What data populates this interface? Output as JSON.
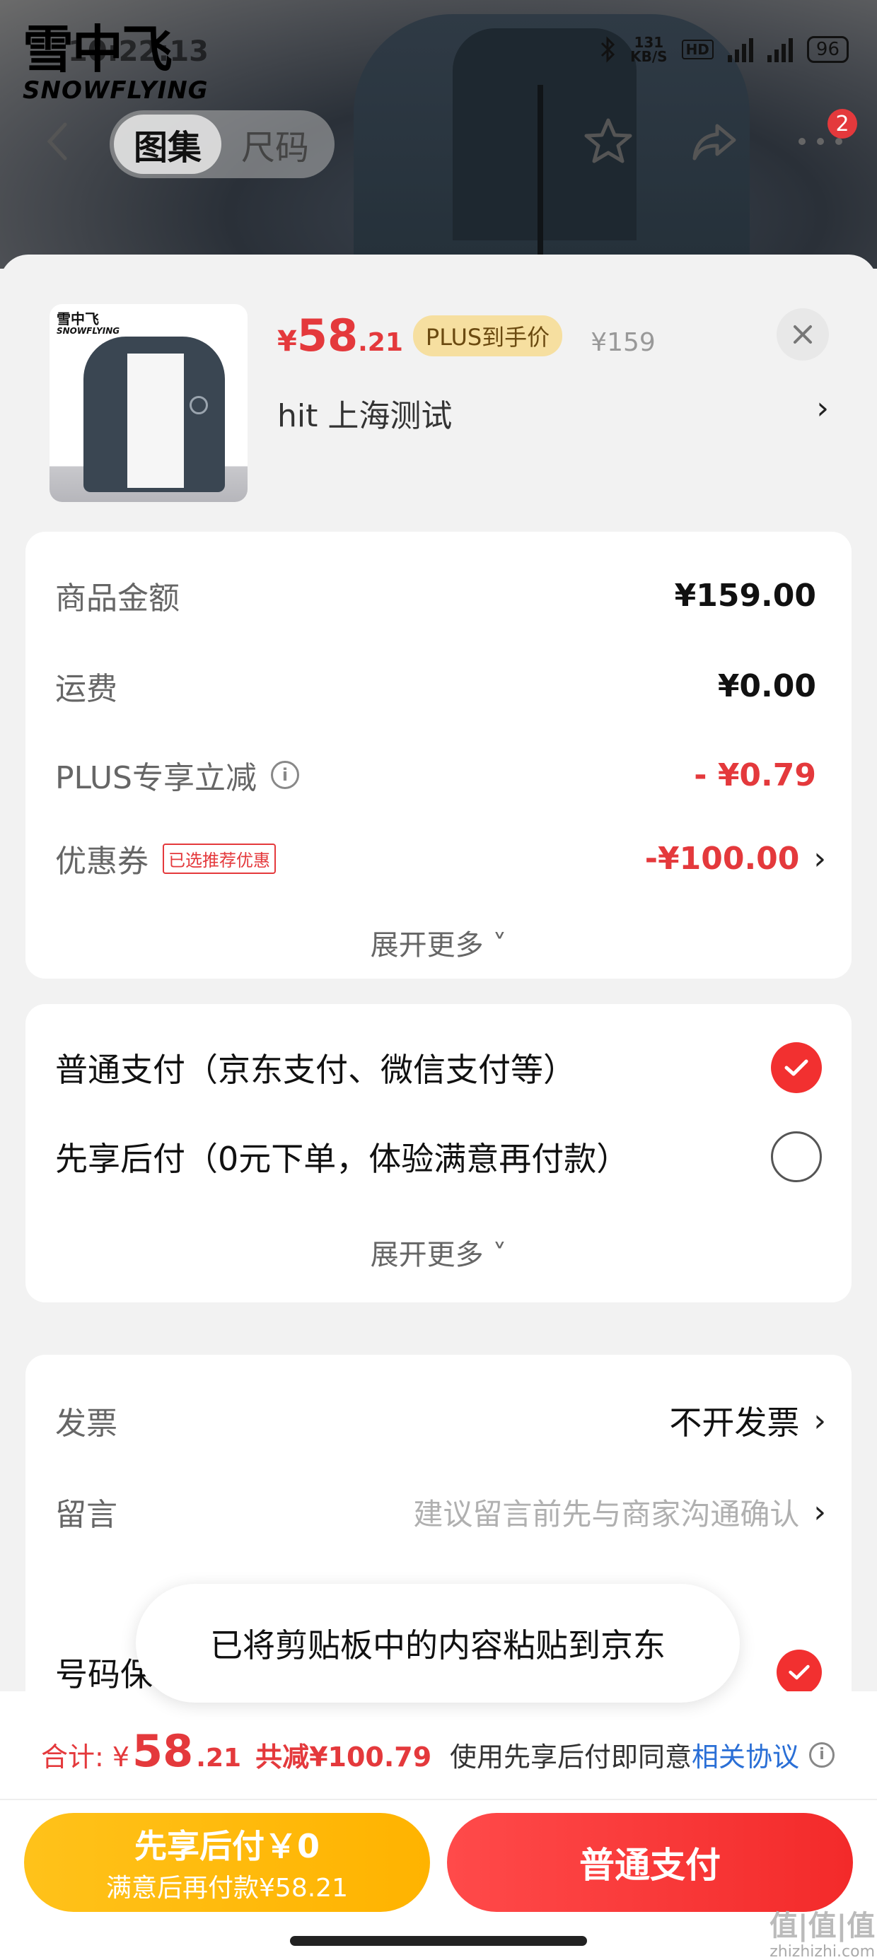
{
  "status_bar": {
    "time": "10:22:13",
    "network_speed": "131",
    "battery": "96"
  },
  "brand": {
    "cn": "雪中飞",
    "en": "SNOWFLYING"
  },
  "nav": {
    "tabs": [
      {
        "label": "图集",
        "active": true
      },
      {
        "label": "尺码",
        "active": false
      }
    ],
    "badge_count": "2"
  },
  "product": {
    "thumb_logo_cn": "雪中飞",
    "thumb_logo_en": "SNOWFLYING",
    "price_symbol": "¥",
    "price_int": "58",
    "price_dec": ".21",
    "plus_tag": "PLUS到手价",
    "original_price": "¥159",
    "address": "hit  上海测试"
  },
  "summary": {
    "rows": [
      {
        "label": "商品金额",
        "value": "¥159.00"
      },
      {
        "label": "运费",
        "value": "¥0.00"
      },
      {
        "label": "PLUS专享立减",
        "value": "- ¥0.79"
      },
      {
        "label": "优惠券",
        "tag": "已选推荐优惠",
        "value": "-¥100.00"
      }
    ],
    "expand": "展开更多"
  },
  "payment": {
    "options": [
      {
        "label": "普通支付（京东支付、微信支付等）",
        "selected": true
      },
      {
        "label": "先享后付（0元下单，体验满意再付款）",
        "selected": false
      }
    ],
    "expand": "展开更多"
  },
  "extra": {
    "invoice_label": "发票",
    "invoice_value": "不开发票",
    "note_label": "留言",
    "note_placeholder": "建议留言前先与商家沟通确认"
  },
  "protect": {
    "label": "号码保"
  },
  "toast": "已将剪贴板中的内容粘贴到京东",
  "bottom": {
    "total_label": "合计:",
    "total_symbol": "¥",
    "total_int": "58",
    "total_dec": ".21",
    "saved": "共减¥100.79",
    "agree_text": "使用先享后付即同意",
    "agree_link": "相关协议",
    "later_btn_line1": "先享后付￥0",
    "later_btn_line2": "满意后再付款¥58.21",
    "pay_btn": "普通支付"
  },
  "watermark": {
    "logo": "值|值|值",
    "site": "zhizhizhi.com"
  },
  "colors": {
    "accent_red": "#e4393c",
    "plus_gold": "#f6dfa0",
    "later_yellow": "#ffb300"
  }
}
